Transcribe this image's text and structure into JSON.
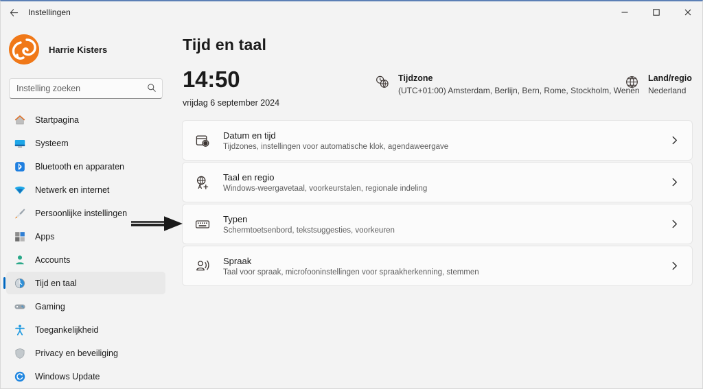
{
  "window": {
    "titlebar_title": "Instellingen",
    "back_icon": "back-arrow-icon",
    "minimize_label": "—",
    "maximize_label": "☐",
    "close_label": "✕"
  },
  "sidebar": {
    "account": {
      "name": "Harrie Kisters",
      "avatar_icon": "user-avatar-logo",
      "avatar_color": "#f07818"
    },
    "search": {
      "placeholder": "Instelling zoeken",
      "value": "",
      "icon": "search-icon"
    },
    "items": [
      {
        "label": "Startpagina",
        "icon": "home-icon",
        "selected": false
      },
      {
        "label": "Systeem",
        "icon": "display-monitor-icon",
        "selected": false
      },
      {
        "label": "Bluetooth en apparaten",
        "icon": "bluetooth-icon",
        "selected": false
      },
      {
        "label": "Netwerk en internet",
        "icon": "wifi-icon",
        "selected": false
      },
      {
        "label": "Persoonlijke instellingen",
        "icon": "paintbrush-icon",
        "selected": false
      },
      {
        "label": "Apps",
        "icon": "apps-grid-icon",
        "selected": false
      },
      {
        "label": "Accounts",
        "icon": "person-icon",
        "selected": false
      },
      {
        "label": "Tijd en taal",
        "icon": "clock-globe-icon",
        "selected": true
      },
      {
        "label": "Gaming",
        "icon": "gamepad-icon",
        "selected": false
      },
      {
        "label": "Toegankelijkheid",
        "icon": "accessibility-person-icon",
        "selected": false
      },
      {
        "label": "Privacy en beveiliging",
        "icon": "shield-icon",
        "selected": false
      },
      {
        "label": "Windows Update",
        "icon": "update-refresh-icon",
        "selected": false
      }
    ],
    "selected_indicator_color": "#0067c0"
  },
  "main": {
    "page_title": "Tijd en taal",
    "clock": {
      "time": "14:50",
      "date": "vrijdag 6 september 2024"
    },
    "timezone": {
      "icon": "clock-globe-icon",
      "title": "Tijdzone",
      "value": "(UTC+01:00) Amsterdam, Berlijn, Bern, Rome, Stockholm, Wenen"
    },
    "region": {
      "icon": "globe-icon",
      "title": "Land/regio",
      "value": "Nederland"
    },
    "cards": [
      {
        "icon": "calendar-clock-icon",
        "title": "Datum en tijd",
        "subtitle": "Tijdzones, instellingen voor automatische klok, agendaweergave",
        "chevron": "chevron-right-icon"
      },
      {
        "icon": "language-globe-icon",
        "title": "Taal en regio",
        "subtitle": "Windows-weergavetaal, voorkeurstalen, regionale indeling",
        "chevron": "chevron-right-icon"
      },
      {
        "icon": "keyboard-icon",
        "title": "Typen",
        "subtitle": "Schermtoetsenbord, tekstsuggesties, voorkeuren",
        "chevron": "chevron-right-icon"
      },
      {
        "icon": "speech-icon",
        "title": "Spraak",
        "subtitle": "Taal voor spraak, microfooninstellingen voor spraakherkenning, stemmen",
        "chevron": "chevron-right-icon"
      }
    ]
  },
  "annotation": {
    "arrow_icon": "annotation-arrow-right",
    "color": "#1a1a1a"
  }
}
